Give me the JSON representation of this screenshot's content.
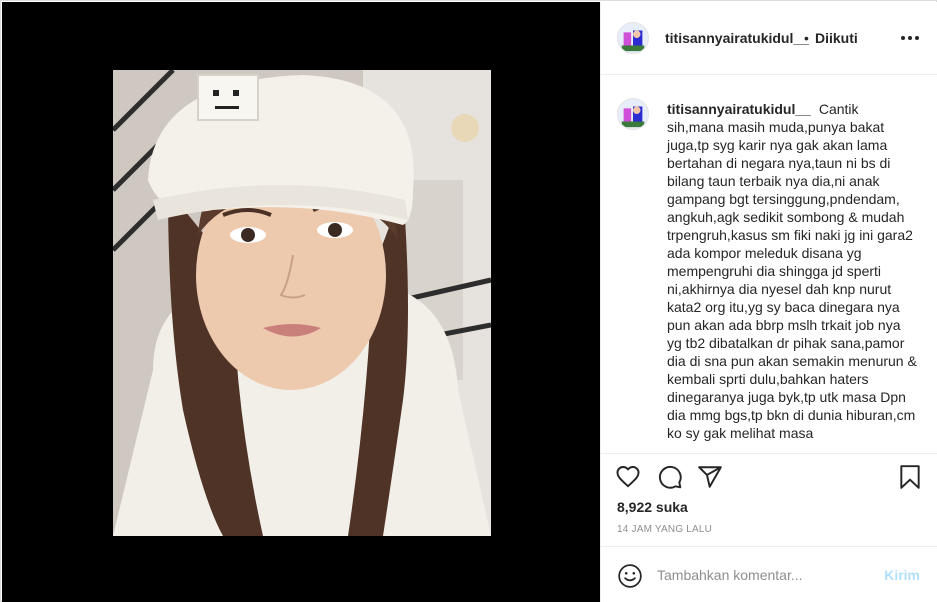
{
  "post": {
    "author": "titisannyairatukidul__",
    "follow_dot": "•",
    "follow_status": "Diikuti",
    "image_icon": "beanie-selfie-photo"
  },
  "caption": {
    "author": "titisannyairatukidul__",
    "text": "Cantik sih,mana masih muda,punya bakat juga,tp syg karir nya gak akan lama bertahan di negara nya,taun ni bs di bilang taun terbaik nya dia,ni anak gampang bgt tersinggung,pndendam, angkuh,agk sedikit sombong & mudah trpengruh,kasus sm fiki naki jg ini gara2 ada kompor meleduk disana yg mempengruhi dia shingga jd sperti ni,akhirnya dia nyesel dah knp nurut kata2 org itu,yg sy baca dinegara nya pun akan ada bbrp mslh trkait job nya yg tb2 dibatalkan dr pihak sana,pamor dia di sna pun akan semakin menurun & kembali sprti dulu,bahkan haters dinegaranya juga byk,tp utk masa Dpn dia mmg bgs,tp bkn di dunia hiburan,cm ko sy gak melihat masa"
  },
  "actions": {
    "like_icon": "heart-icon",
    "comment_icon": "comment-icon",
    "share_icon": "share-icon",
    "save_icon": "bookmark-icon"
  },
  "stats": {
    "likes": "8,922 suka",
    "time": "14 JAM YANG LALU"
  },
  "composer": {
    "placeholder": "Tambahkan komentar...",
    "value": "",
    "post_label": "Kirim",
    "emoji_icon": "emoji-icon"
  },
  "colors": {
    "post_button_disabled": "#b2dffc",
    "secondary_text": "#8e8e8e",
    "border": "#efefef"
  }
}
